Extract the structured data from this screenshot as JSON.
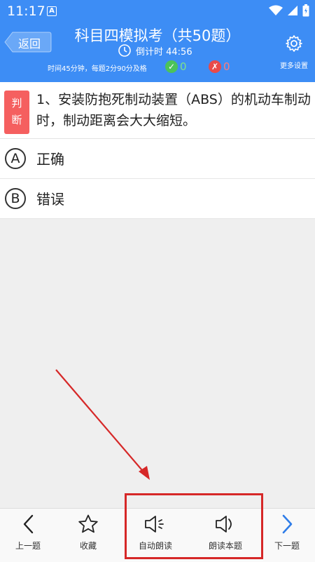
{
  "status_bar": {
    "time": "11:17",
    "a_icon": "A"
  },
  "header": {
    "back_label": "返回",
    "title": "科目四模拟考（共50题）",
    "timer": "倒计时 44:56",
    "rules": "时间45分钟，每题2分90分及格",
    "correct_count": "0",
    "wrong_count": "0",
    "settings_label": "更多设置"
  },
  "question": {
    "tag_line1": "判",
    "tag_line2": "断",
    "text": "1、安装防抱死制动装置（ABS）的机动车制动时，制动距离会大大缩短。"
  },
  "options": [
    {
      "letter": "A",
      "text": "正确"
    },
    {
      "letter": "B",
      "text": "错误"
    }
  ],
  "bottom_nav": {
    "prev": "上一题",
    "favorite": "收藏",
    "auto_read": "自动朗读",
    "read_question": "朗读本题",
    "next": "下一题"
  },
  "colors": {
    "header": "#3d8df5",
    "tag": "#f55f5f",
    "annotation": "#d62828"
  }
}
